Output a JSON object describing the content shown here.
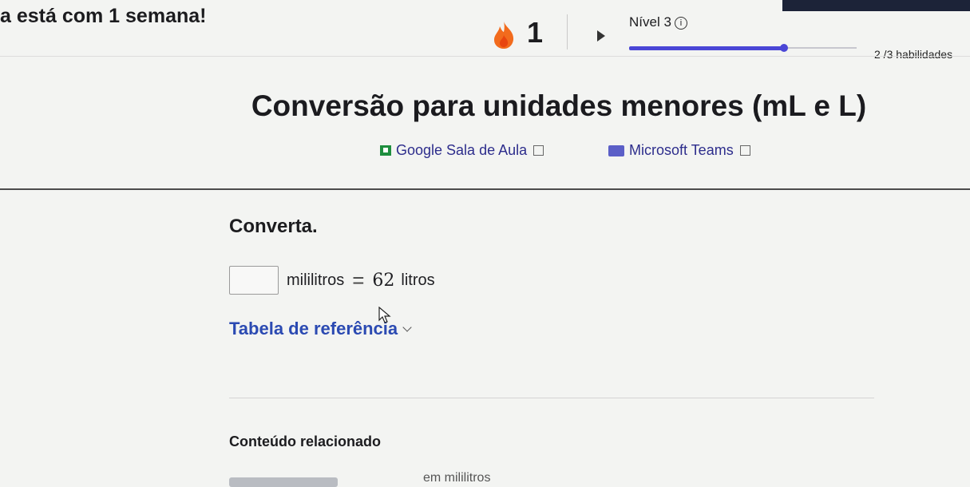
{
  "header": {
    "streak_message": "a está com 1 semana!",
    "streak_count": "1",
    "level_label": "Nível 3",
    "info_glyph": "i",
    "level_progress": 0.68,
    "skills_label": "2 /3 habilidades"
  },
  "lesson": {
    "title": "Conversão para unidades menores (mL e L)",
    "share": {
      "google_label": "Google Sala de Aula",
      "teams_label": "Microsoft Teams"
    }
  },
  "exercise": {
    "prompt": "Converta.",
    "unit_left": "mililitros",
    "equals": "=",
    "value": "62",
    "unit_right": "litros",
    "answer_value": "",
    "reference_table_label": "Tabela de referência"
  },
  "related": {
    "heading": "Conteúdo relacionado",
    "partial_link": "em mililitros"
  },
  "icons": [
    "flame-icon",
    "play-icon",
    "info-icon",
    "google-classroom-icon",
    "microsoft-teams-icon",
    "external-link-icon",
    "chevron-down-icon",
    "cursor-icon"
  ],
  "colors": {
    "accent": "#4a46d6",
    "link": "#2b4ab2",
    "flame": "#f26b1d"
  }
}
